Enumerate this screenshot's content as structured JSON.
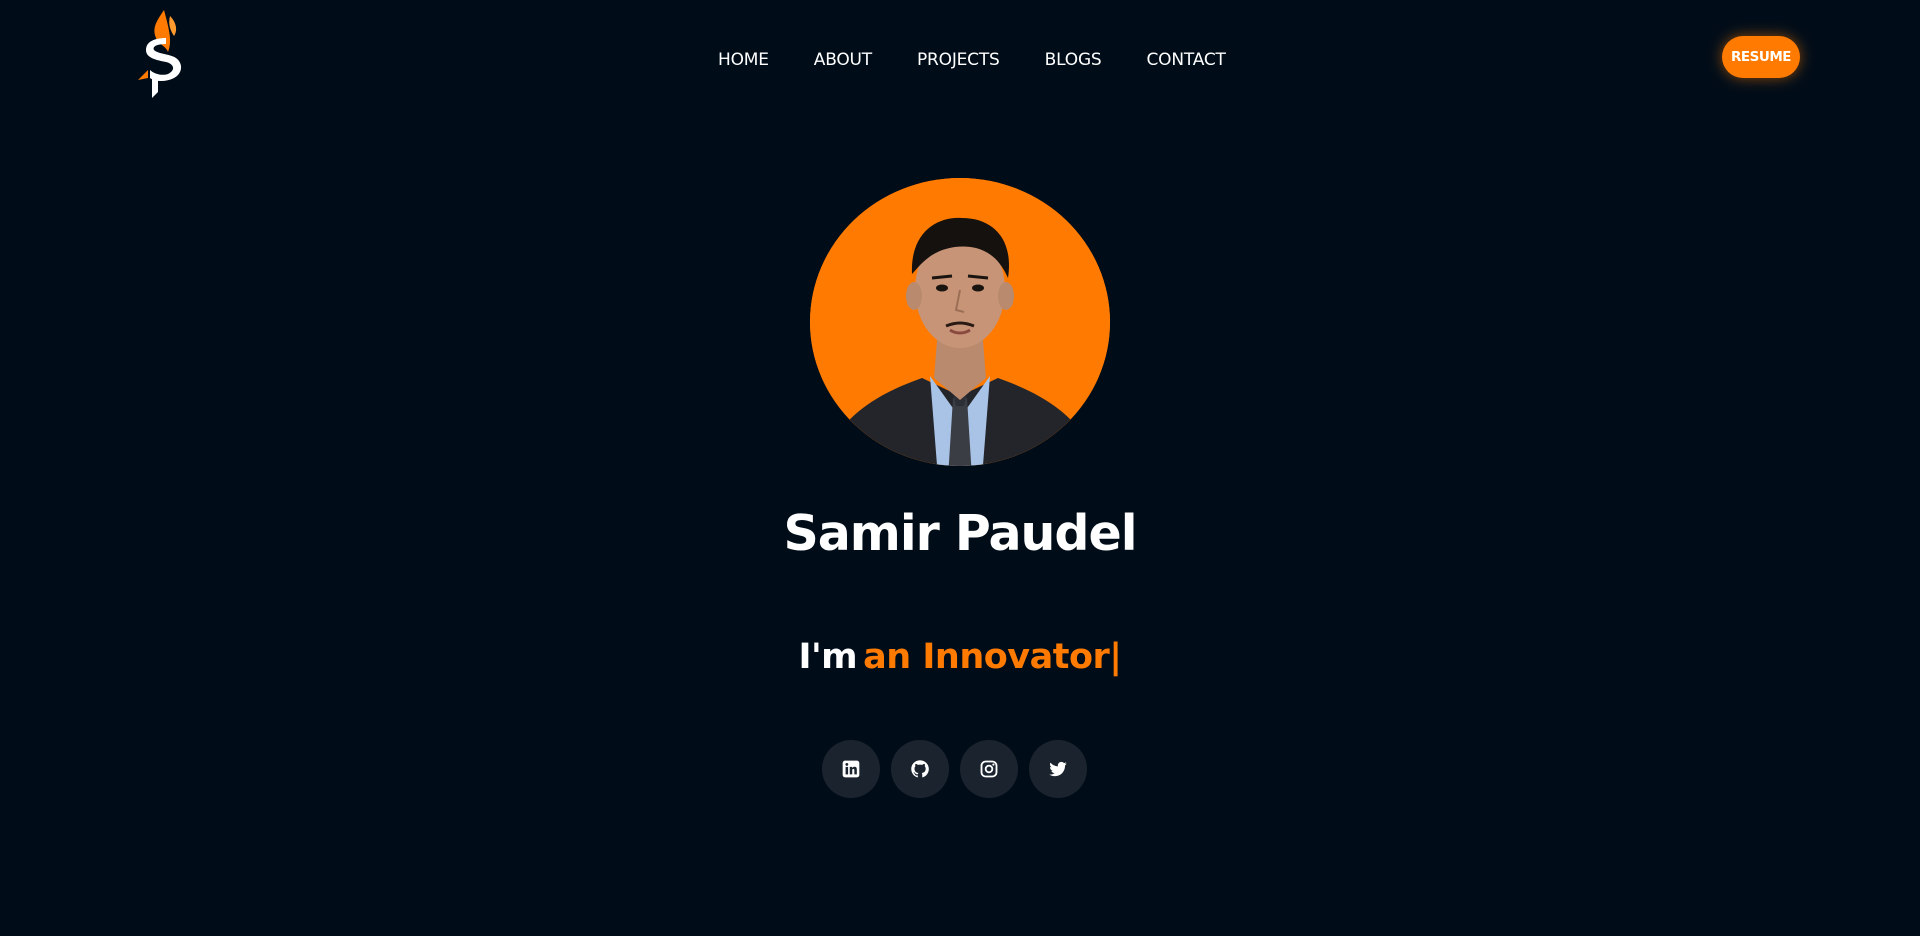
{
  "header": {
    "logo_icon": "sp-flame-logo",
    "nav": [
      {
        "label": "HOME"
      },
      {
        "label": "ABOUT"
      },
      {
        "label": "PROJECTS"
      },
      {
        "label": "BLOGS"
      },
      {
        "label": "CONTACT"
      }
    ],
    "resume_label": "RESUME"
  },
  "hero": {
    "avatar_icon": "profile-photo",
    "name": "Samir Paudel",
    "tagline_prefix": "I'm",
    "tagline_role": "an Innovator",
    "tagline_cursor": "|"
  },
  "social": [
    {
      "icon": "linkedin-icon"
    },
    {
      "icon": "github-icon"
    },
    {
      "icon": "instagram-icon"
    },
    {
      "icon": "twitter-icon"
    }
  ],
  "colors": {
    "background": "#000d19",
    "accent": "#ff7a00",
    "text": "#ffffff",
    "social_bg": "#1b242e"
  }
}
